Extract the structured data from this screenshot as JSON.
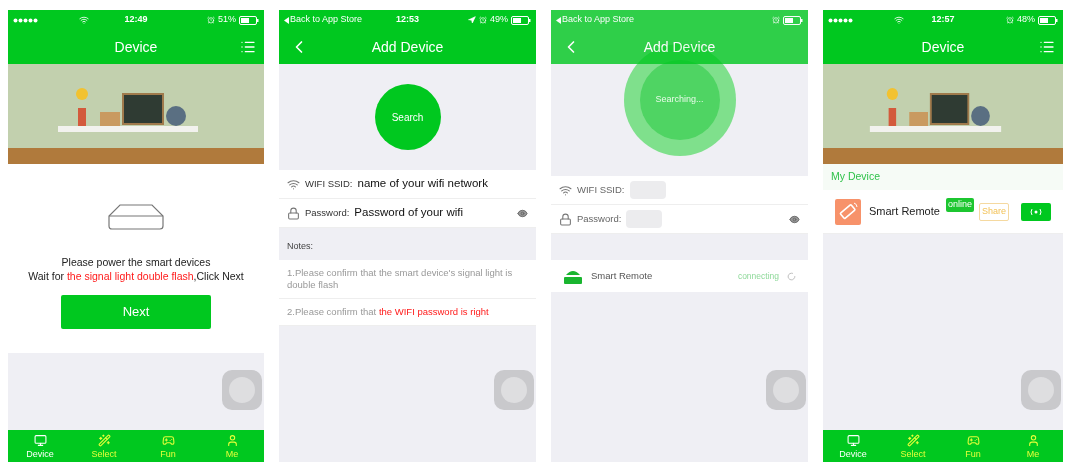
{
  "screens": [
    {
      "kind": "home",
      "status_bar": {
        "kind": "signal",
        "time": "12:49",
        "battery": "51%",
        "indicators": [
          {
            "kind": "alarm"
          }
        ]
      },
      "nav": {
        "kind": "root",
        "title": "Device"
      },
      "prompt": [
        {
          "parts": [
            {
              "text": "Please power the smart devices",
              "alert": false
            }
          ]
        },
        {
          "parts": [
            {
              "text": "Wait for ",
              "alert": false
            },
            {
              "text": "the signal light double flash",
              "alert": true
            },
            {
              "text": ",Click Next",
              "alert": false
            }
          ]
        }
      ],
      "next_button": "Next",
      "tabs": [
        {
          "label": "Device",
          "selected": true
        },
        {
          "label": "Select",
          "selected": false
        },
        {
          "label": "Fun",
          "selected": false
        },
        {
          "label": "Me",
          "selected": false
        }
      ]
    },
    {
      "kind": "add_device",
      "status_bar": {
        "kind": "back",
        "label": "Back to App Store",
        "time": "12:53",
        "battery": "49%",
        "indicators": [
          {
            "kind": "location"
          },
          {
            "kind": "alarm"
          }
        ]
      },
      "nav": {
        "kind": "sub",
        "title": "Add Device"
      },
      "search_button": "Search",
      "ssid": {
        "label": "WIFI SSID:",
        "value": "name of your wifi network"
      },
      "password": {
        "label": "Password:",
        "value": "Password of your wifi"
      },
      "notes_header": "Notes:",
      "notes": [
        {
          "parts": [
            {
              "text": "1.Please confirm that the smart device's signal light is double flash",
              "alert": false
            }
          ]
        },
        {
          "parts": [
            {
              "text": "2.Please confirm that ",
              "alert": false
            },
            {
              "text": "the WIFI password is right",
              "alert": true
            }
          ]
        }
      ]
    },
    {
      "kind": "searching",
      "status_bar": {
        "kind": "back",
        "label": "Back to App Store",
        "indicators": [
          {
            "kind": "alarm"
          }
        ]
      },
      "nav": {
        "kind": "sub",
        "title": "Add Device"
      },
      "searching_label": "Searching...",
      "ssid": {
        "label": "WIFI SSID:"
      },
      "password": {
        "label": "Password:"
      },
      "found": [
        {
          "name": "Smart Remote",
          "status": "connecting"
        }
      ]
    },
    {
      "kind": "device_list",
      "status_bar": {
        "kind": "signal",
        "time": "12:57",
        "battery": "48%",
        "indicators": [
          {
            "kind": "alarm"
          }
        ]
      },
      "nav": {
        "kind": "root",
        "title": "Device"
      },
      "section": "My Device",
      "devices": [
        {
          "name": "Smart Remote",
          "status": "online",
          "share": "Share"
        }
      ],
      "tabs": [
        {
          "label": "Device",
          "selected": true
        },
        {
          "label": "Select",
          "selected": false
        },
        {
          "label": "Fun",
          "selected": false
        },
        {
          "label": "Me",
          "selected": false
        }
      ]
    }
  ]
}
